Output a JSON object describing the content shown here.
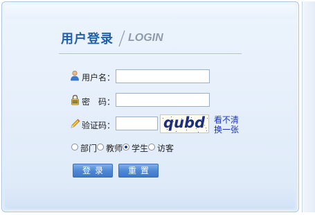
{
  "header": {
    "title_cn": "用户登录",
    "title_en": "LOGIN"
  },
  "form": {
    "username_label": "用户名：",
    "username_value": "",
    "password_label": "密　码：",
    "password_value": "",
    "captcha_label": "验证码：",
    "captcha_value": "",
    "captcha_image_text": "qubd",
    "captcha_refresh_label": "看不清换一张"
  },
  "roles": {
    "options": [
      "部门",
      "教师",
      "学生",
      "访客"
    ],
    "selected": "学生"
  },
  "buttons": {
    "login_label": "登录",
    "reset_label": "重置"
  },
  "colors": {
    "title": "#2260a8",
    "title_en": "#8e9aab",
    "link": "#1a34b8",
    "button": "#4f89d6"
  }
}
